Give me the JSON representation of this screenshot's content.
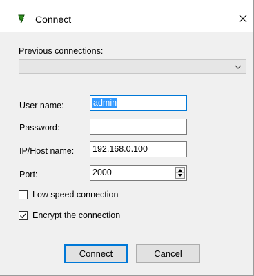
{
  "window": {
    "title": "Connect",
    "app_icon": "green-plug-icon",
    "close_icon": "close-icon"
  },
  "previous": {
    "label": "Previous connections:",
    "value": "",
    "dropdown_icon": "chevron-down-icon"
  },
  "form": {
    "username_label": "User name:",
    "username_value": "admin",
    "password_label": "Password:",
    "password_value": "",
    "host_label": "IP/Host name:",
    "host_value": "192.168.0.100",
    "port_label": "Port:",
    "port_value": "2000"
  },
  "options": {
    "low_speed_label": "Low speed connection",
    "low_speed_checked": false,
    "encrypt_label": "Encrypt the connection",
    "encrypt_checked": true
  },
  "buttons": {
    "connect_label": "Connect",
    "cancel_label": "Cancel"
  },
  "colors": {
    "accent": "#0078d7",
    "selection": "#3399ff",
    "icon_green": "#2e8b1e"
  }
}
